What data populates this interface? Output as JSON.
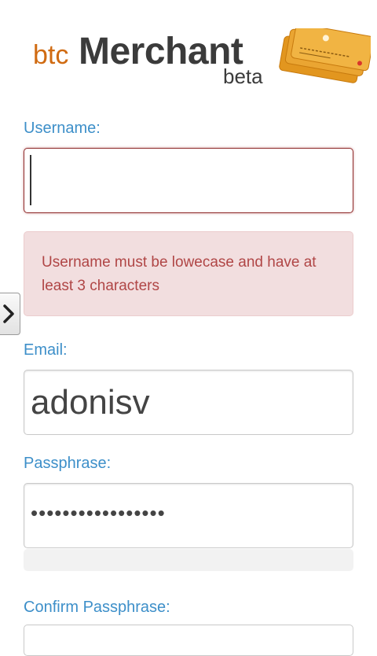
{
  "logo": {
    "prefix": "btc",
    "name": "Merchant",
    "tag": "beta"
  },
  "form": {
    "username_label": "Username:",
    "username_value": "",
    "error_message": "Username must be lowecase and have at least 3 characters",
    "email_label": "Email:",
    "email_value": "adonisv",
    "passphrase_label": "Passphrase:",
    "passphrase_masked": "•••••••••••••••••",
    "confirm_label": "Confirm Passphrase:"
  },
  "colors": {
    "label": "#3d8fc9",
    "error_text": "#b04646",
    "error_bg": "#f2dedf",
    "brand_orange": "#d06b12"
  },
  "icons": {
    "side_toggle": "chevron-right-icon",
    "logo_art": "bitcoin-cards-icon"
  }
}
